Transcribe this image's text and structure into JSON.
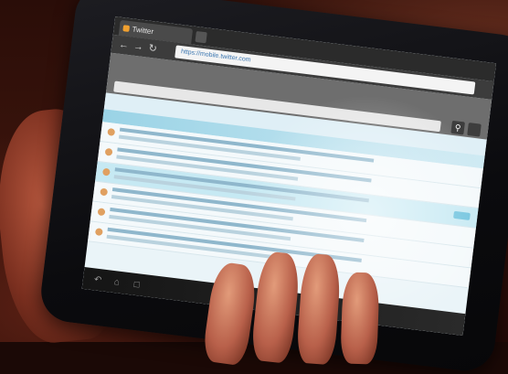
{
  "browser": {
    "tab_title": "Twitter",
    "url": "https://mobile.twitter.com"
  },
  "colors": {
    "screen_bg": "#eaf4f8",
    "header_gray": "#6e6e6e",
    "accent_blue": "#6fc3de",
    "bezel": "#0b0b0e",
    "skin": "#b8604a"
  },
  "icons": {
    "back": "arrow-left-icon",
    "forward": "arrow-right-icon",
    "reload": "reload-icon",
    "search": "search-icon",
    "menu": "menu-icon"
  }
}
